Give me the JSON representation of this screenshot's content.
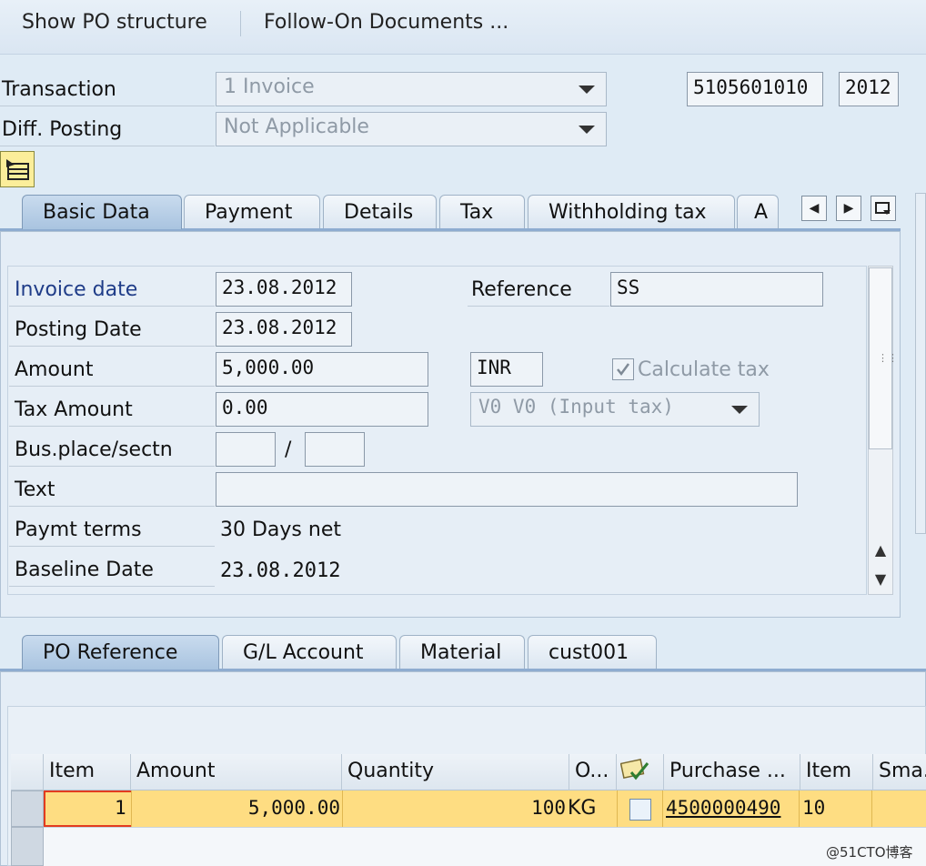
{
  "toolbar": {
    "show_po_structure": "Show PO structure",
    "follow_on_documents": "Follow-On Documents ..."
  },
  "header": {
    "transaction_label": "Transaction",
    "transaction_value": "1 Invoice",
    "diff_posting_label": "Diff. Posting",
    "diff_posting_value": "Not Applicable",
    "document_number": "5105601010",
    "fiscal_year": "2012"
  },
  "tabs_top": [
    {
      "label": "Basic Data",
      "active": true
    },
    {
      "label": "Payment"
    },
    {
      "label": "Details"
    },
    {
      "label": "Tax"
    },
    {
      "label": "Withholding tax"
    },
    {
      "label": "A"
    }
  ],
  "basic_data": {
    "invoice_date_label": "Invoice date",
    "invoice_date": "23.08.2012",
    "posting_date_label": "Posting Date",
    "posting_date": "23.08.2012",
    "amount_label": "Amount",
    "amount": "5,000.00",
    "currency": "INR",
    "tax_amount_label": "Tax Amount",
    "tax_amount": "0.00",
    "tax_code": "V0 V0 (Input tax)",
    "calculate_tax_label": "Calculate tax",
    "bus_place_label": "Bus.place/sectn",
    "bus_place_sep": "/",
    "text_label": "Text",
    "reference_label": "Reference",
    "reference": "SS",
    "paymt_terms_label": "Paymt terms",
    "paymt_terms": "30 Days net",
    "baseline_date_label": "Baseline Date",
    "baseline_date": "23.08.2012"
  },
  "tabs_bottom": [
    {
      "label": "PO Reference",
      "active": true
    },
    {
      "label": "G/L Account"
    },
    {
      "label": "Material"
    },
    {
      "label": "cust001"
    }
  ],
  "grid": {
    "columns": [
      "Item",
      "Amount",
      "Quantity",
      "O...",
      "",
      "Purchase ...",
      "Item",
      "Sma..."
    ],
    "rows": [
      {
        "item": "1",
        "amount": "5,000.00",
        "quantity": "100",
        "unit": "KG",
        "checked": false,
        "purchase": "4500000490",
        "po_item": "10",
        "sma": ""
      }
    ]
  },
  "watermark": "@51CTO博客"
}
